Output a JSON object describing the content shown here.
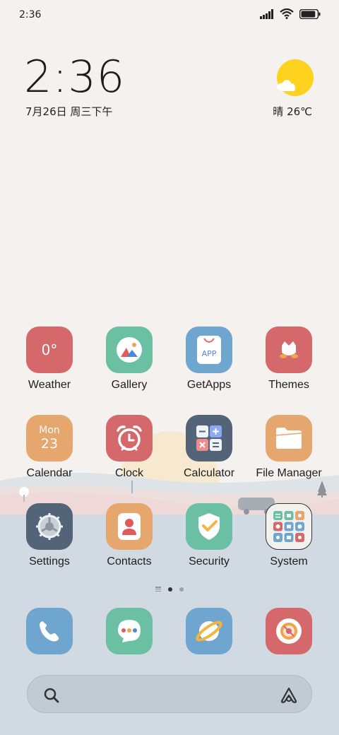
{
  "status_bar": {
    "time": "2:36",
    "battery_level": 0.9
  },
  "clock_widget": {
    "time": "2:36",
    "date": "7月26日 周三下午"
  },
  "weather_widget": {
    "condition_temp": "晴 26℃",
    "icon": "sun-cloud-icon"
  },
  "apps": {
    "row1": [
      {
        "label": "Weather",
        "icon": "weather-icon",
        "color": "#d4686a",
        "text": "0°"
      },
      {
        "label": "Gallery",
        "icon": "gallery-icon",
        "color": "#6bbfa3"
      },
      {
        "label": "GetApps",
        "icon": "getapps-icon",
        "color": "#6fa6d0",
        "text": "APP"
      },
      {
        "label": "Themes",
        "icon": "themes-icon",
        "color": "#d4686a"
      }
    ],
    "row2": [
      {
        "label": "Calendar",
        "icon": "calendar-icon",
        "color": "#e6a76e",
        "day": "Mon",
        "date": "23"
      },
      {
        "label": "Clock",
        "icon": "clock-icon",
        "color": "#d4686a"
      },
      {
        "label": "Calculator",
        "icon": "calculator-icon",
        "color": "#536479"
      },
      {
        "label": "File Manager",
        "icon": "folder-icon",
        "color": "#e6a76e"
      }
    ],
    "row3": [
      {
        "label": "Settings",
        "icon": "settings-icon",
        "color": "#536479"
      },
      {
        "label": "Contacts",
        "icon": "contacts-icon",
        "color": "#e6a76e"
      },
      {
        "label": "Security",
        "icon": "security-icon",
        "color": "#6bbfa3"
      },
      {
        "label": "System",
        "icon": "folder-grid-icon",
        "color": "#f3f1ee"
      }
    ]
  },
  "page_indicator": {
    "pages": 2,
    "current": 1
  },
  "dock": [
    {
      "name": "phone",
      "icon": "phone-icon",
      "color": "#6fa6d0"
    },
    {
      "name": "messages",
      "icon": "messages-icon",
      "color": "#6bbfa3"
    },
    {
      "name": "browser",
      "icon": "browser-icon",
      "color": "#6fa6d0"
    },
    {
      "name": "camera",
      "icon": "camera-icon",
      "color": "#d4686a"
    }
  ],
  "search_bar": {
    "search_icon": "search-icon",
    "assistant_icon": "assistant-icon"
  }
}
